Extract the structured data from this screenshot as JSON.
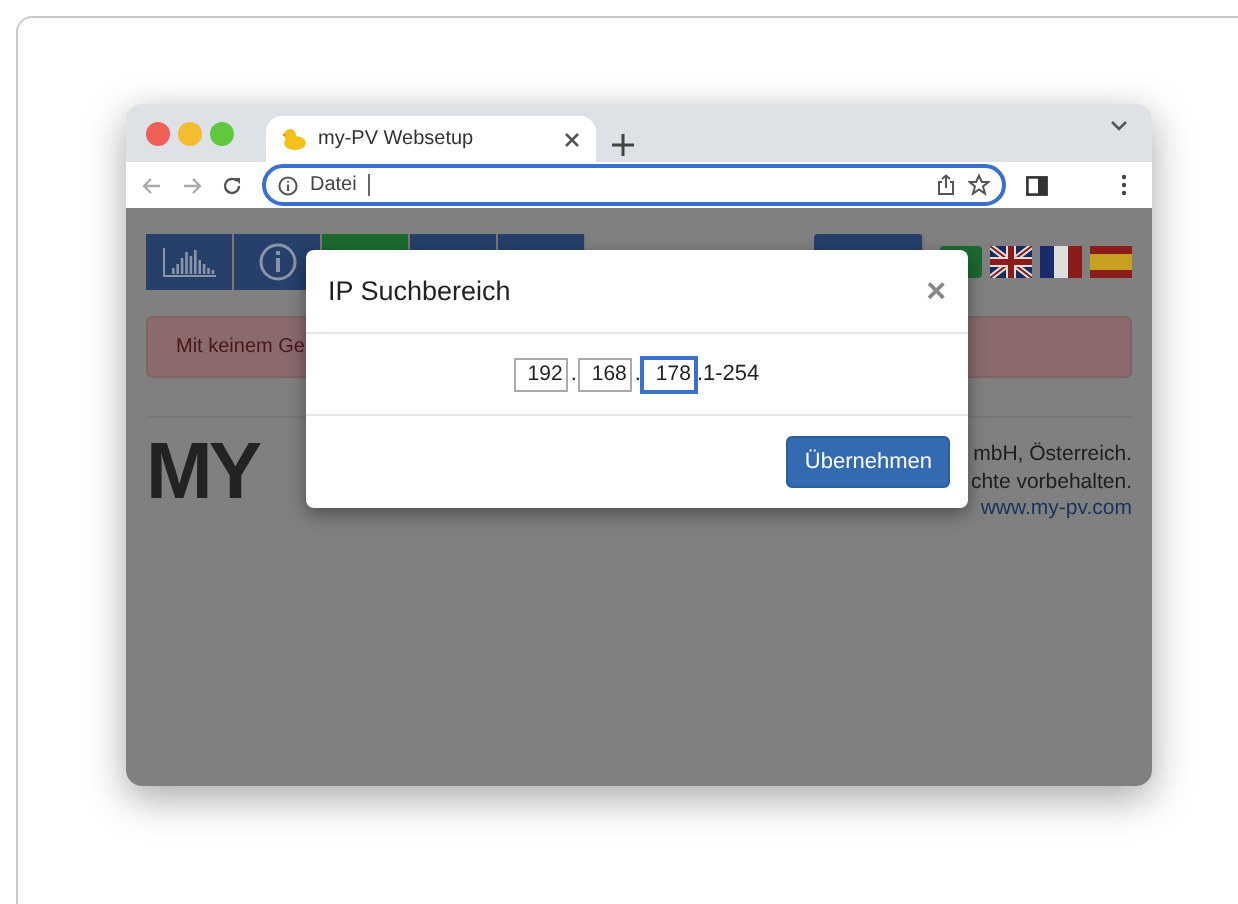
{
  "browser": {
    "tabs": [
      {
        "title": "my-PV Websetup",
        "selected": true
      }
    ],
    "address": {
      "label": "Datei"
    }
  },
  "page": {
    "alert": "Mit keinem Ge",
    "logo": "MY",
    "footer": [
      "mbH, Österreich.",
      "chte vorbehalten."
    ],
    "link": "www.my-pv.com"
  },
  "dialog": {
    "title": "IP Suchbereich",
    "close": "×",
    "octets": [
      {
        "value": "192",
        "focused": false
      },
      {
        "value": "168",
        "focused": false
      },
      {
        "value": "178",
        "focused": true
      }
    ],
    "separator": ".",
    "suffix": ".1-254",
    "button": "Übernehmen"
  }
}
